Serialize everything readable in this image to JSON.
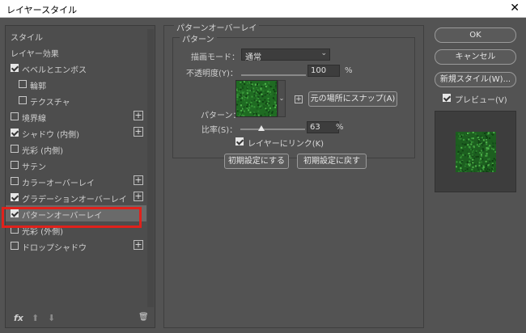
{
  "window": {
    "title": "レイヤースタイル",
    "close_glyph": "✕"
  },
  "left_panel": {
    "headers": [
      "スタイル",
      "レイヤー効果"
    ],
    "items": [
      {
        "label": "ベベルとエンボス",
        "checked": true,
        "plus": false
      },
      {
        "label": "輪郭",
        "checked": false,
        "plus": false
      },
      {
        "label": "テクスチャ",
        "checked": false,
        "plus": false
      },
      {
        "label": "境界線",
        "checked": false,
        "plus": true
      },
      {
        "label": "シャドウ (内側)",
        "checked": true,
        "plus": true
      },
      {
        "label": "光彩 (内側)",
        "checked": false,
        "plus": false
      },
      {
        "label": "サテン",
        "checked": false,
        "plus": false
      },
      {
        "label": "カラーオーバーレイ",
        "checked": false,
        "plus": true
      },
      {
        "label": "グラデーションオーバーレイ",
        "checked": true,
        "plus": true
      },
      {
        "label": "パターンオーバーレイ",
        "checked": true,
        "plus": false,
        "selected": true
      },
      {
        "label": "光彩 (外側)",
        "checked": false,
        "plus": false
      },
      {
        "label": "ドロップシャドウ",
        "checked": false,
        "plus": true
      }
    ],
    "plus_glyph": "+",
    "bottom_icons": [
      {
        "name": "fx-icon",
        "glyph": "fx"
      },
      {
        "name": "move-up-icon",
        "glyph": "⬆"
      },
      {
        "name": "move-down-icon",
        "glyph": "⬇"
      },
      {
        "name": "trash-icon",
        "glyph": "🗑"
      }
    ]
  },
  "pattern_overlay": {
    "section_title": "パターンオーバーレイ",
    "group_title": "パターン",
    "blend_mode_label": "描画モード：",
    "blend_mode_value": "通常",
    "opacity_label": "不透明度(Y)：",
    "opacity_value": "100",
    "opacity_unit": "%",
    "opacity_fraction": 1.0,
    "pattern_label": "パターン：",
    "snap_button": "元の場所にスナップ(A)",
    "scale_label": "比率(S)：",
    "scale_value": "63",
    "scale_unit": "%",
    "scale_fraction": 0.33,
    "link_label": "レイヤーにリンク(K)",
    "link_checked": true,
    "default_set_button": "初期設定にする",
    "default_reset_button": "初期設定に戻す",
    "pattern_color": "#1f6b22",
    "dropdown_glyph": "⌄",
    "plus_glyph": "+"
  },
  "right_panel": {
    "ok_button": "OK",
    "cancel_button": "キャンセル",
    "new_style_button": "新規スタイル(W)...",
    "preview_label": "プレビュー(V)",
    "preview_checked": true
  },
  "colors": {
    "background": "#535353",
    "highlight": "#e0211b",
    "selected_row": "#6a6a6a"
  }
}
